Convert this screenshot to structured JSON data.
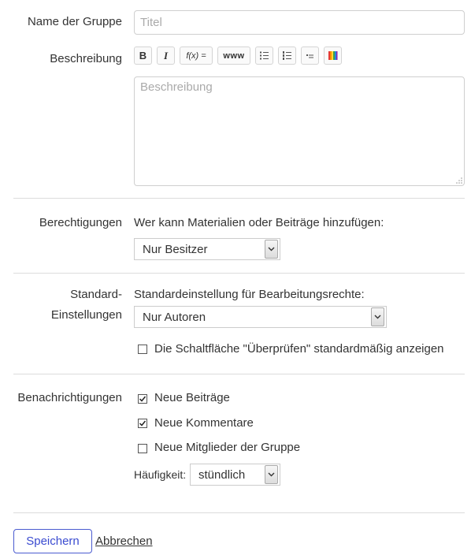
{
  "group_name": {
    "label": "Name der Gruppe",
    "placeholder": "Titel"
  },
  "description": {
    "label": "Beschreibung",
    "placeholder": "Beschreibung",
    "toolbar": {
      "bold": "B",
      "italic": "I",
      "formula": "f(x) =",
      "link": "www"
    }
  },
  "permissions": {
    "label": "Berechtigungen",
    "question": "Wer kann Materialien oder Beiträge hinzufügen:",
    "selected": "Nur Besitzer"
  },
  "defaults": {
    "label_line1": "Standard-",
    "label_line2": "Einstellungen",
    "question": "Standardeinstellung für Bearbeitungsrechte:",
    "selected": "Nur Autoren",
    "review_checkbox": "Die Schaltfläche \"Überprüfen\" standardmäßig anzeigen"
  },
  "notifications": {
    "label": "Benachrichtigungen",
    "items": [
      {
        "label": "Neue Beiträge",
        "checked": true
      },
      {
        "label": "Neue Kommentare",
        "checked": true
      },
      {
        "label": "Neue Mitglieder der Gruppe",
        "checked": false
      }
    ],
    "frequency_label": "Häufigkeit:",
    "frequency_selected": "stündlich"
  },
  "actions": {
    "save": "Speichern",
    "cancel": "Abbrechen"
  },
  "colors": {
    "accent": "#3a4bd0",
    "border": "#cfcfcf",
    "divider": "#dcdcdc"
  }
}
